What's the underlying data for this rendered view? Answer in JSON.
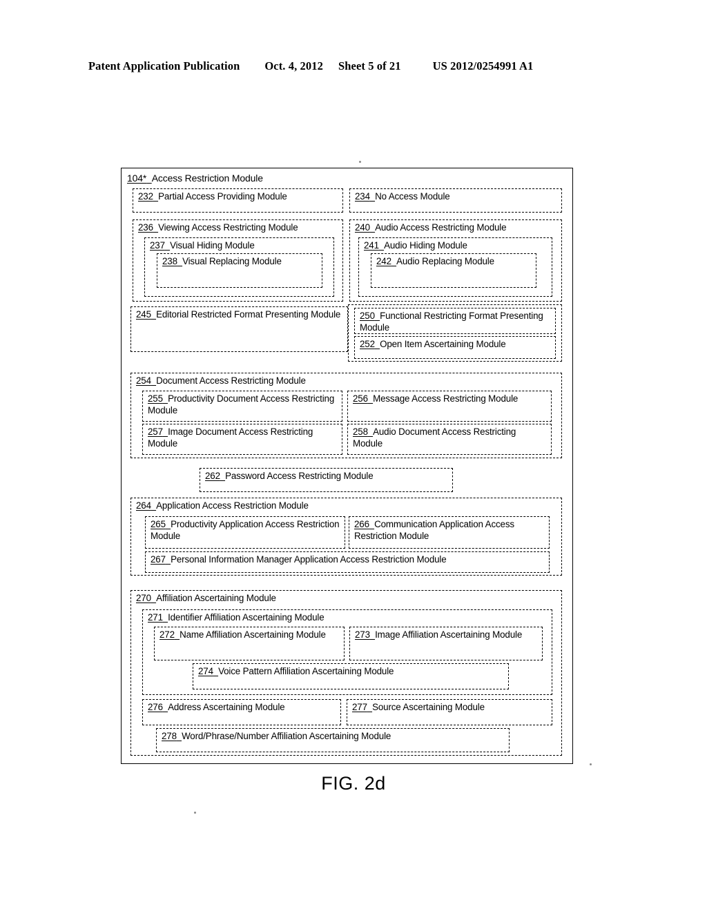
{
  "header": {
    "publication": "Patent Application Publication",
    "date": "Oct. 4, 2012",
    "sheet": "Sheet 5 of 21",
    "number": "US 2012/0254991 A1"
  },
  "figure": {
    "caption": "FIG. 2d",
    "root": {
      "num": "104*",
      "label": "Access Restriction Module"
    },
    "modules": {
      "m232": {
        "num": "232",
        "label": "Partial Access Providing Module"
      },
      "m234": {
        "num": "234",
        "label": "No Access Module"
      },
      "m236": {
        "num": "236",
        "label": "Viewing Access Restricting Module"
      },
      "m237": {
        "num": "237",
        "label": "Visual Hiding Module"
      },
      "m238": {
        "num": "238",
        "label": "Visual Replacing Module"
      },
      "m240": {
        "num": "240",
        "label": "Audio Access Restricting Module"
      },
      "m241": {
        "num": "241",
        "label": "Audio Hiding Module"
      },
      "m242": {
        "num": "242",
        "label": "Audio Replacing Module"
      },
      "m245": {
        "num": "245",
        "label": "Editorial Restricted Format Presenting Module"
      },
      "m250": {
        "num": "250",
        "label": "Functional Restricting Format Presenting Module"
      },
      "m252": {
        "num": "252",
        "label": "Open Item Ascertaining Module"
      },
      "m254": {
        "num": "254",
        "label": "Document Access Restricting Module"
      },
      "m255": {
        "num": "255",
        "label": "Productivity Document Access Restricting Module"
      },
      "m256": {
        "num": "256",
        "label": "Message Access Restricting Module"
      },
      "m257": {
        "num": "257",
        "label": "Image Document Access Restricting Module"
      },
      "m258": {
        "num": "258",
        "label": "Audio Document Access Restricting Module"
      },
      "m262": {
        "num": "262",
        "label": "Password Access Restricting Module"
      },
      "m264": {
        "num": "264",
        "label": "Application Access Restriction Module"
      },
      "m265": {
        "num": "265",
        "label": "Productivity Application Access Restriction Module"
      },
      "m266": {
        "num": "266",
        "label": "Communication Application Access Restriction Module"
      },
      "m267": {
        "num": "267",
        "label": "Personal Information Manager Application Access Restriction Module"
      },
      "m270": {
        "num": "270",
        "label": "Affiliation Ascertaining Module"
      },
      "m271": {
        "num": "271",
        "label": "Identifier Affiliation Ascertaining Module"
      },
      "m272": {
        "num": "272",
        "label": "Name Affiliation Ascertaining Module"
      },
      "m273": {
        "num": "273",
        "label": "Image Affiliation Ascertaining Module"
      },
      "m274": {
        "num": "274",
        "label": "Voice Pattern Affiliation Ascertaining Module"
      },
      "m276": {
        "num": "276",
        "label": "Address Ascertaining Module"
      },
      "m277": {
        "num": "277",
        "label": "Source Ascertaining Module"
      },
      "m278": {
        "num": "278",
        "label": "Word/Phrase/Number Affiliation Ascertaining Module"
      }
    }
  }
}
